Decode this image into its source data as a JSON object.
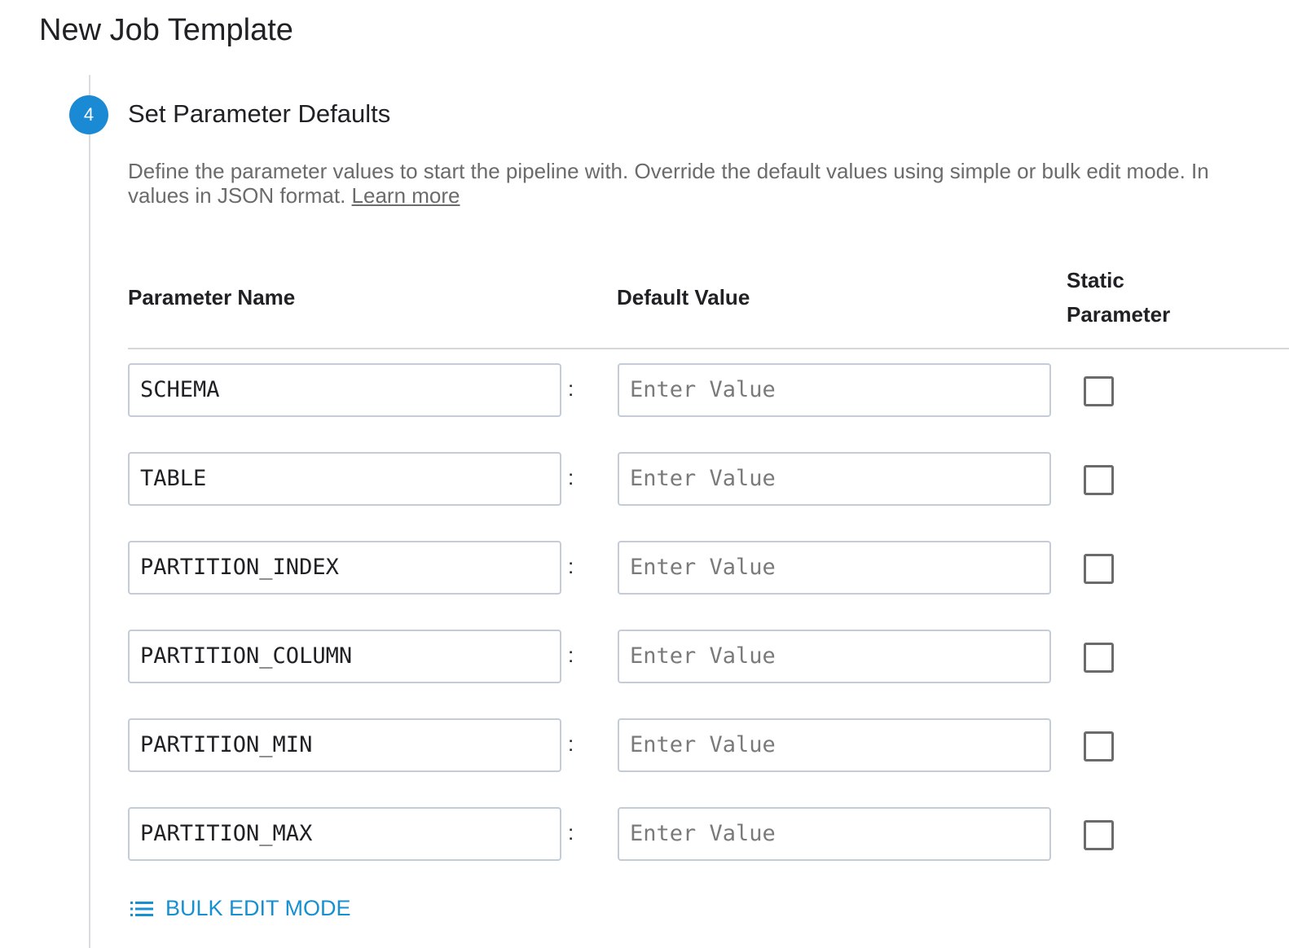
{
  "page": {
    "title": "New Job Template"
  },
  "step": {
    "number": "4",
    "title": "Set Parameter Defaults",
    "description_line1": "Define the parameter values to start the pipeline with. Override the default values using simple or bulk edit mode. In",
    "description_line2": "values in JSON format. ",
    "learn_more": "Learn more",
    "accent_color": "#1a8ad4"
  },
  "table": {
    "headers": {
      "name": "Parameter Name",
      "value": "Default Value",
      "static_line1": "Static",
      "static_line2": "Parameter"
    },
    "separator": ":",
    "value_placeholder": "Enter Value",
    "rows": [
      {
        "name": "SCHEMA",
        "value": "",
        "static": false
      },
      {
        "name": "TABLE",
        "value": "",
        "static": false
      },
      {
        "name": "PARTITION_INDEX",
        "value": "",
        "static": false
      },
      {
        "name": "PARTITION_COLUMN",
        "value": "",
        "static": false
      },
      {
        "name": "PARTITION_MIN",
        "value": "",
        "static": false
      },
      {
        "name": "PARTITION_MAX",
        "value": "",
        "static": false
      }
    ]
  },
  "bulk_edit": {
    "label": "BULK EDIT MODE",
    "icon": "list-icon",
    "color": "#1790d2"
  }
}
